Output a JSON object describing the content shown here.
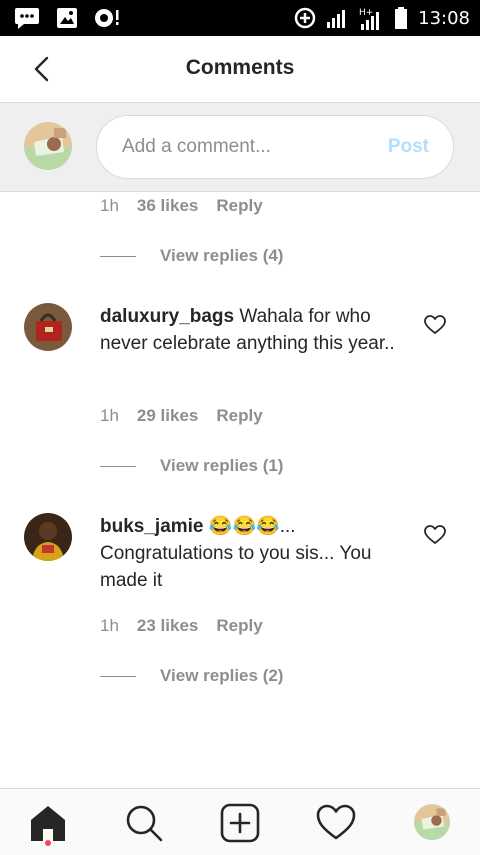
{
  "status_bar": {
    "time": "13:08",
    "network": "H+"
  },
  "header": {
    "title": "Comments"
  },
  "composer": {
    "placeholder": "Add a comment...",
    "post_label": "Post"
  },
  "partial_comment": {
    "time": "1h",
    "likes": "36 likes",
    "reply": "Reply",
    "view_replies": "View replies (4)"
  },
  "comments": [
    {
      "username": "daluxury_bags",
      "text": "Wahala for who never celebrate anything this year..",
      "time": "1h",
      "likes": "29 likes",
      "reply": "Reply",
      "view_replies": "View replies (1)"
    },
    {
      "username": "buks_jamie",
      "text": "😂😂😂... Congratulations to you sis... You made it",
      "time": "1h",
      "likes": "23 likes",
      "reply": "Reply",
      "view_replies": "View replies (2)"
    }
  ],
  "bottom_nav": [
    {
      "icon": "home-icon",
      "active": true
    },
    {
      "icon": "search-icon",
      "active": false
    },
    {
      "icon": "add-post-icon",
      "active": false
    },
    {
      "icon": "heart-icon",
      "active": false
    },
    {
      "icon": "profile-avatar",
      "active": false
    }
  ],
  "colors": {
    "text": "#262626",
    "secondary": "#8e8e8e",
    "post_disabled": "#b3dffc",
    "notification_dot": "#ed4956"
  }
}
